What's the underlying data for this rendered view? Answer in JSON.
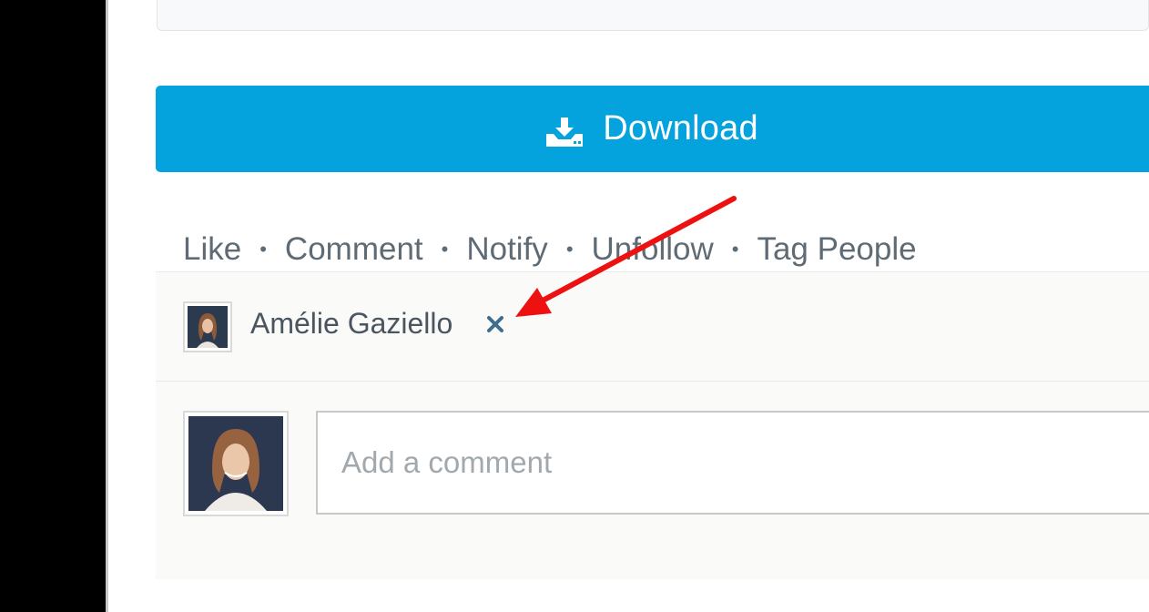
{
  "download": {
    "label": "Download",
    "icon": "download-tray-icon",
    "color": "#04a3de"
  },
  "actions": [
    {
      "label": "Like"
    },
    {
      "label": "Comment"
    },
    {
      "label": "Notify"
    },
    {
      "label": "Unfollow"
    },
    {
      "label": "Tag People"
    }
  ],
  "separator": "•",
  "tagged": {
    "name": "Amélie Gaziello",
    "remove_icon": "close-icon"
  },
  "comment": {
    "placeholder": "Add a comment"
  },
  "annotation": {
    "arrow_color": "#ee1111"
  }
}
